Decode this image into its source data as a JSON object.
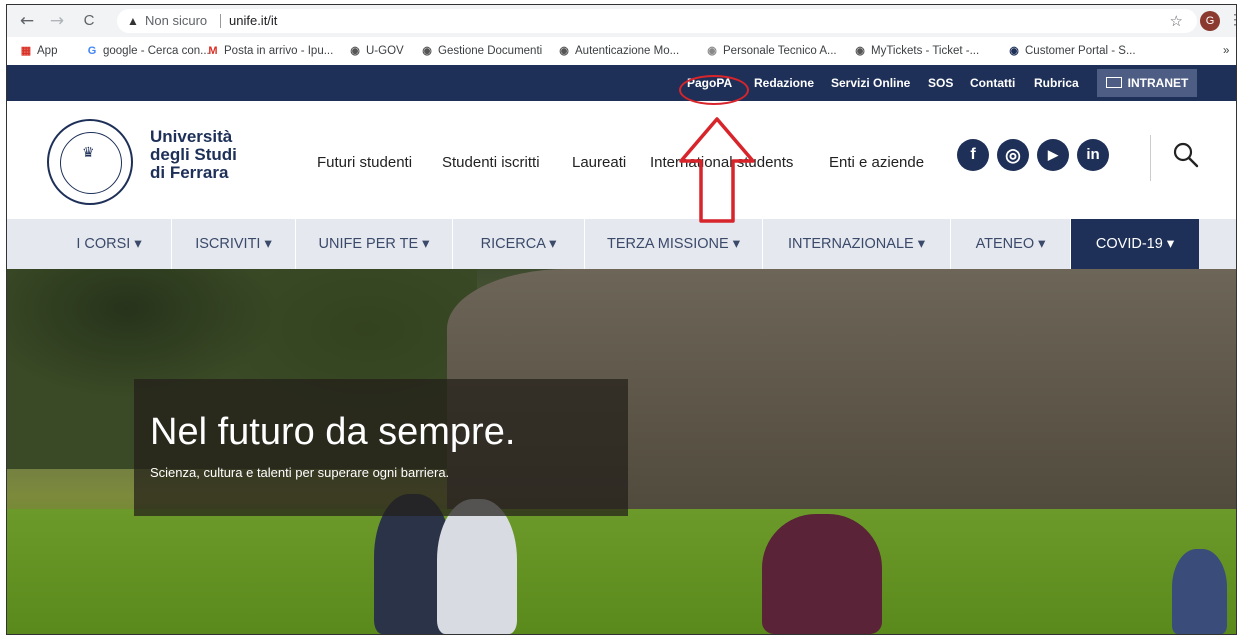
{
  "browser": {
    "back_glyph": "←",
    "forward_glyph": "→",
    "reload_glyph": "C",
    "security_label": "Non sicuro",
    "url": "unife.it/it",
    "profile_initial": "G",
    "bookmarks": [
      {
        "label": "App",
        "icon": "apps-grid-icon",
        "color": "#d93025"
      },
      {
        "label": "google - Cerca con...",
        "icon": "google-icon",
        "color": "#4285f4"
      },
      {
        "label": "Posta in arrivo - Ipu...",
        "icon": "gmail-icon",
        "color": "#d93025"
      },
      {
        "label": "U-GOV",
        "icon": "ugov-icon",
        "color": "#555555"
      },
      {
        "label": "Gestione Documenti",
        "icon": "globe-icon",
        "color": "#555555"
      },
      {
        "label": "Autenticazione Mo...",
        "icon": "globe-icon",
        "color": "#555555"
      },
      {
        "label": "Personale Tecnico A...",
        "icon": "unife-icon",
        "color": "#888888"
      },
      {
        "label": "MyTickets - Ticket -...",
        "icon": "mytickets-icon",
        "color": "#555555"
      },
      {
        "label": "Customer Portal - S...",
        "icon": "portal-icon",
        "color": "#1e3058"
      }
    ],
    "more_bookmarks": "»"
  },
  "util_bar": {
    "links": [
      "PagoPA",
      "Redazione",
      "Servizi Online",
      "SOS",
      "Contatti",
      "Rubrica"
    ],
    "intranet_label": "INTRANET"
  },
  "header": {
    "brand_line1": "Università",
    "brand_line2": "degli Studi",
    "brand_line3": "di Ferrara",
    "menu": [
      "Futuri studenti",
      "Studenti iscritti",
      "Laureati",
      "International students",
      "Enti e aziende"
    ],
    "social": [
      {
        "icon": "facebook-icon",
        "glyph": "f"
      },
      {
        "icon": "instagram-icon",
        "glyph": "◎"
      },
      {
        "icon": "youtube-icon",
        "glyph": "▶"
      },
      {
        "icon": "linkedin-icon",
        "glyph": "in"
      }
    ]
  },
  "main_nav": [
    "I CORSI ▾",
    "ISCRIVITI ▾",
    "UNIFE PER TE ▾",
    "RICERCA ▾",
    "TERZA MISSIONE ▾",
    "INTERNAZIONALE ▾",
    "ATENEO ▾",
    "COVID-19 ▾"
  ],
  "hero": {
    "title": "Nel futuro da sempre.",
    "subtitle": "Scienza, cultura e talenti per superare ogni barriera."
  },
  "colors": {
    "navy": "#1e3058",
    "annotation_red": "#d8242b"
  }
}
